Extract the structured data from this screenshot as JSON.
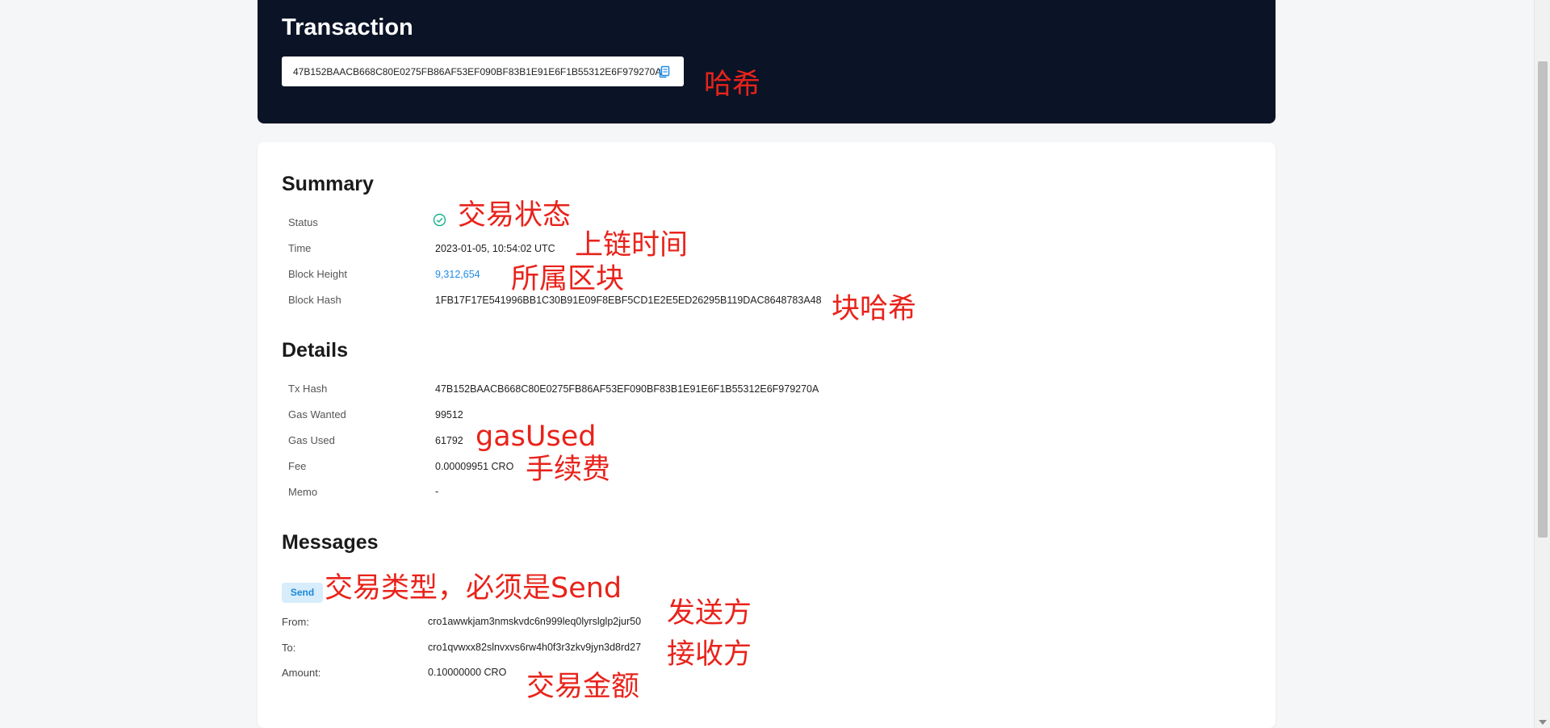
{
  "header": {
    "title": "Transaction",
    "tx_hash": "47B152BAACB668C80E0275FB86AF53EF090BF83B1E91E6F1B55312E6F979270A",
    "copy_icon": "copy-icon"
  },
  "summary": {
    "title": "Summary",
    "status": {
      "label": "Status",
      "icon": "check-circle-icon",
      "color": "#14b38a"
    },
    "time": {
      "label": "Time",
      "value": "2023-01-05, 10:54:02 UTC"
    },
    "block_height": {
      "label": "Block Height",
      "value": "9,312,654"
    },
    "block_hash": {
      "label": "Block Hash",
      "value": "1FB17F17E541996BB1C30B91E09F8EBF5CD1E2E5ED26295B119DAC8648783A48"
    }
  },
  "details": {
    "title": "Details",
    "tx_hash": {
      "label": "Tx Hash",
      "value": "47B152BAACB668C80E0275FB86AF53EF090BF83B1E91E6F1B55312E6F979270A"
    },
    "gas_wanted": {
      "label": "Gas Wanted",
      "value": "99512"
    },
    "gas_used": {
      "label": "Gas Used",
      "value": "61792"
    },
    "fee": {
      "label": "Fee",
      "value": "0.00009951 CRO"
    },
    "memo": {
      "label": "Memo",
      "value": "-"
    }
  },
  "messages": {
    "title": "Messages",
    "type_badge": "Send",
    "from": {
      "label": "From:",
      "value": "cro1awwkjam3nmskvdc6n999leq0lyrslglp2jur50"
    },
    "to": {
      "label": "To:",
      "value": "cro1qvwxx82slnvxvs6rw4h0f3r3zkv9jyn3d8rd27"
    },
    "amount": {
      "label": "Amount:",
      "value": "0.10000000 CRO"
    }
  },
  "annotations": {
    "hash": "哈希",
    "status": "交易状态",
    "time": "上链时间",
    "block": "所属区块",
    "block_hash": "块哈希",
    "gas_used": "gasUsed",
    "fee": "手续费",
    "type": "交易类型，必须是Send",
    "from": "发送方",
    "to": "接收方",
    "amount": "交易金额"
  },
  "colors": {
    "header_bg": "#0b1426",
    "link": "#1f8ce6",
    "annotation": "#e8231b",
    "badge_bg": "#d7edfb"
  }
}
